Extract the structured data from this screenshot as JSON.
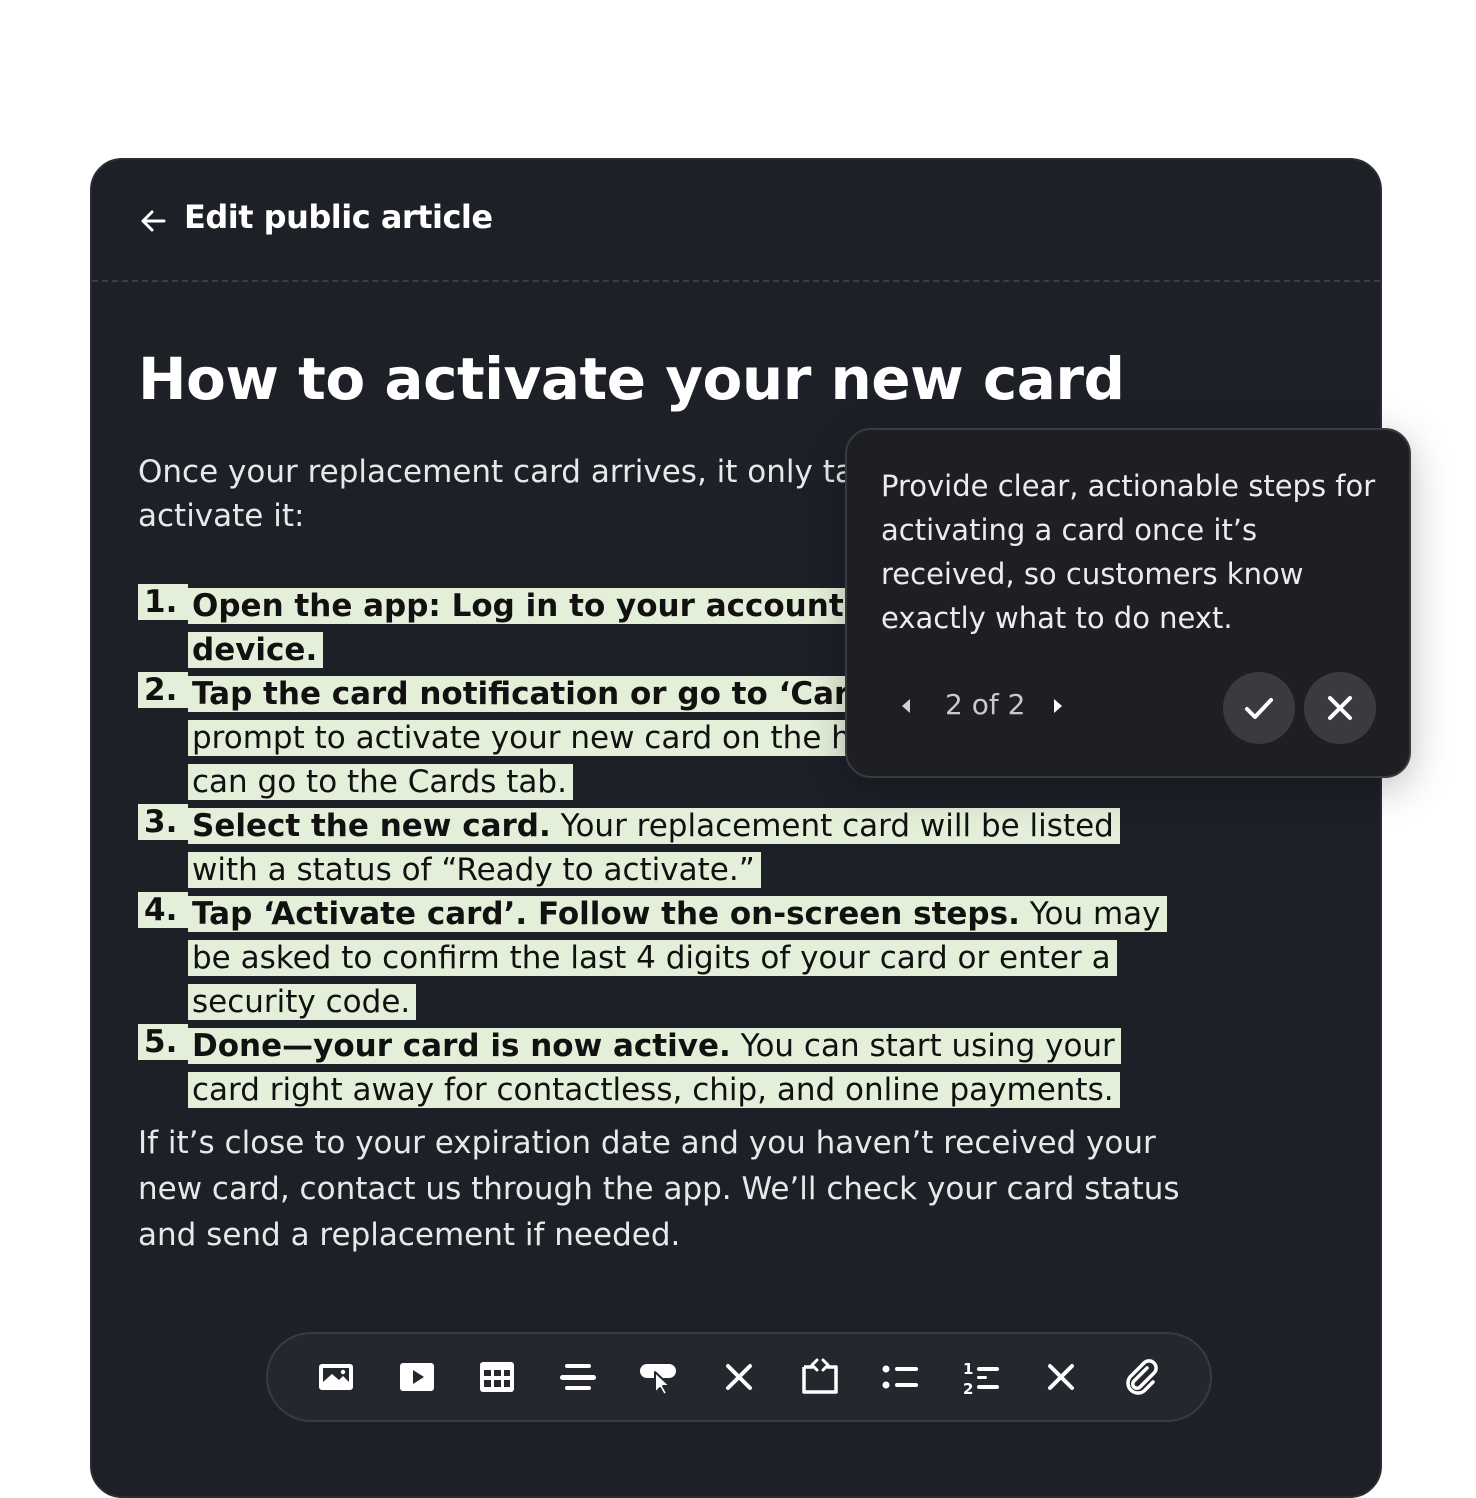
{
  "header": {
    "title": "Edit public article",
    "back_icon": "arrow-left-icon"
  },
  "article": {
    "title": "How to activate your new card",
    "intro": "Once your replacement card arrives, it only takes a few steps to activate it:",
    "steps": [
      {
        "number": "1.",
        "bold": "Open the app: Log in to your account on your mobile device.",
        "rest": ""
      },
      {
        "number": "2.",
        "bold": "Tap the card notification or go to ‘Cards.’",
        "rest": " You’ll see a prompt to activate your new card on the home screen, or you can go to the Cards tab."
      },
      {
        "number": "3.",
        "bold": "Select the new card.",
        "rest": " Your replacement card will be listed with a status of “Ready to activate.”"
      },
      {
        "number": "4.",
        "bold": "Tap ‘Activate card’. Follow the on-screen steps.",
        "rest": " You may be asked to confirm the last 4 digits of your card or enter a security code."
      },
      {
        "number": "5.",
        "bold": "Done—your card is now active.",
        "rest": " You can start using your card right away for contactless, chip, and online payments."
      }
    ],
    "outro": "If it’s close to your expiration date and you haven’t received your new card, contact us through the app. We’ll check your card status and send a replacement if needed."
  },
  "suggestion": {
    "text": "Provide clear, actionable steps for activating a card once it’s received, so customers know exactly what to do next.",
    "pager": "2 of 2",
    "accept_icon": "check-icon",
    "reject_icon": "close-icon"
  },
  "toolbar": {
    "tools": [
      "image-icon",
      "video-icon",
      "table-icon",
      "divider-icon",
      "button-icon",
      "close-icon",
      "code-icon",
      "bullet-list-icon",
      "numbered-list-icon",
      "close-icon",
      "attachment-icon"
    ]
  },
  "colors": {
    "panel_bg": "#1d2027",
    "highlight": "#e3efd9",
    "popover_bg": "#1e1f22"
  }
}
